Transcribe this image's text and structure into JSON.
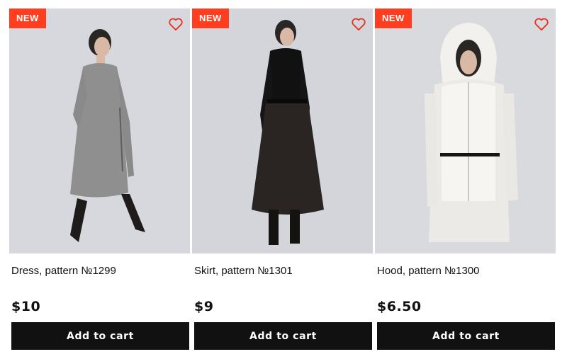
{
  "products": [
    {
      "badge": "NEW",
      "title": "Dress, pattern №1299",
      "price": "$10",
      "button": "Add to cart",
      "photo_background": "#d6d8dd",
      "garment_color": "#8e8e8e"
    },
    {
      "badge": "NEW",
      "title": "Skirt, pattern №1301",
      "price": "$9",
      "button": "Add to cart",
      "photo_background": "#d3d5da",
      "garment_color": "#1a1a1a"
    },
    {
      "badge": "NEW",
      "title": "Hood, pattern №1300",
      "price": "$6.50",
      "button": "Add to cart",
      "photo_background": "#d9dadd",
      "garment_color": "#ecebe8"
    }
  ],
  "colors": {
    "badge_red": "#ff3d1f",
    "button_black": "#111111",
    "heart_red": "#e8321f"
  },
  "icons": {
    "favorite": "heart-outline-icon"
  }
}
